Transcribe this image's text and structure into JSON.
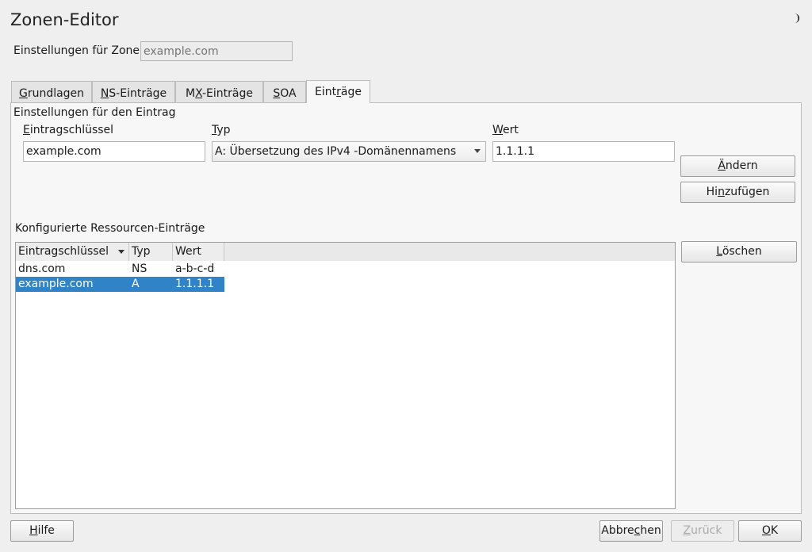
{
  "window": {
    "title": "Zonen-Editor"
  },
  "zone": {
    "label": "Einstellungen für Zone",
    "placeholder": "example.com"
  },
  "tabs": [
    {
      "pre": "",
      "u": "G",
      "post": "rundlagen"
    },
    {
      "pre": "",
      "u": "N",
      "post": "S-Einträge"
    },
    {
      "pre": "M",
      "u": "X",
      "post": "-Einträge"
    },
    {
      "pre": "",
      "u": "S",
      "post": "OA"
    },
    {
      "pre": "Eint",
      "u": "r",
      "post": "äge"
    }
  ],
  "entry": {
    "group_label": "Einstellungen für den Eintrag",
    "key_label": {
      "u": "E",
      "post": "intragschlüssel"
    },
    "key_value": "example.com",
    "type_label": {
      "u": "T",
      "post": "yp"
    },
    "type_value": "A: Übersetzung des IPv4 -Domänennamens",
    "value_label": {
      "u": "W",
      "post": "ert"
    },
    "value_value": "1.1.1.1"
  },
  "buttons": {
    "change": {
      "u": "Ä",
      "post": "ndern"
    },
    "add": {
      "pre": "Hi",
      "u": "n",
      "post": "zufügen"
    },
    "delete": {
      "u": "L",
      "post": "öschen"
    },
    "help": {
      "u": "H",
      "post": "ilfe"
    },
    "cancel": {
      "pre": "Abbre",
      "u": "c",
      "post": "hen"
    },
    "back": {
      "u": "Z",
      "post": "urück"
    },
    "ok": {
      "u": "O",
      "post": "K"
    }
  },
  "records": {
    "label": "Konfigurierte Ressourcen-Einträge",
    "columns": [
      "Eintragschlüssel",
      "Typ",
      "Wert"
    ],
    "rows": [
      {
        "key": "dns.com",
        "type": "NS",
        "value": "a-b-c-d"
      },
      {
        "key": "example.com",
        "type": "A",
        "value": "1.1.1.1"
      }
    ]
  },
  "colors": {
    "selection": "#2f83c6",
    "background": "#efefef"
  }
}
